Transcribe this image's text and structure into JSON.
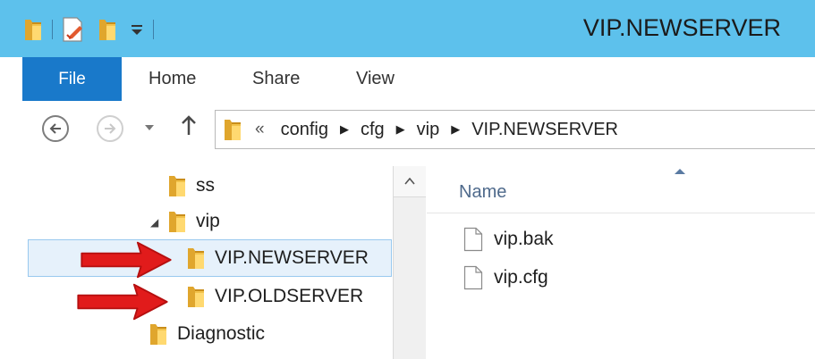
{
  "window": {
    "title": "VIP.NEWSERVER"
  },
  "ribbon": {
    "file_tab": "File",
    "tabs": [
      {
        "label": "Home"
      },
      {
        "label": "Share"
      },
      {
        "label": "View"
      }
    ]
  },
  "navigation": {
    "address_overflow": "«",
    "breadcrumbs": [
      "config",
      "cfg",
      "vip",
      "VIP.NEWSERVER"
    ]
  },
  "tree": {
    "items": [
      {
        "label": "ss"
      },
      {
        "label": "vip"
      },
      {
        "label": "VIP.NEWSERVER"
      },
      {
        "label": "VIP.OLDSERVER"
      },
      {
        "label": "Diagnostic"
      }
    ]
  },
  "file_list": {
    "column_name": "Name",
    "files": [
      {
        "name": "vip.bak"
      },
      {
        "name": "vip.cfg"
      }
    ]
  },
  "colors": {
    "title_bar": "#5dc1ec",
    "file_tab": "#1979ca",
    "selection": "#e6f1fb",
    "folder": "#e8b43a",
    "annotation_arrow": "#e11b1b"
  },
  "icons": {
    "folder": "folder-icon",
    "document": "document-icon",
    "back": "back-arrow-icon",
    "forward": "forward-arrow-icon",
    "up": "up-arrow-icon",
    "annotation": "red-arrow-icon"
  }
}
